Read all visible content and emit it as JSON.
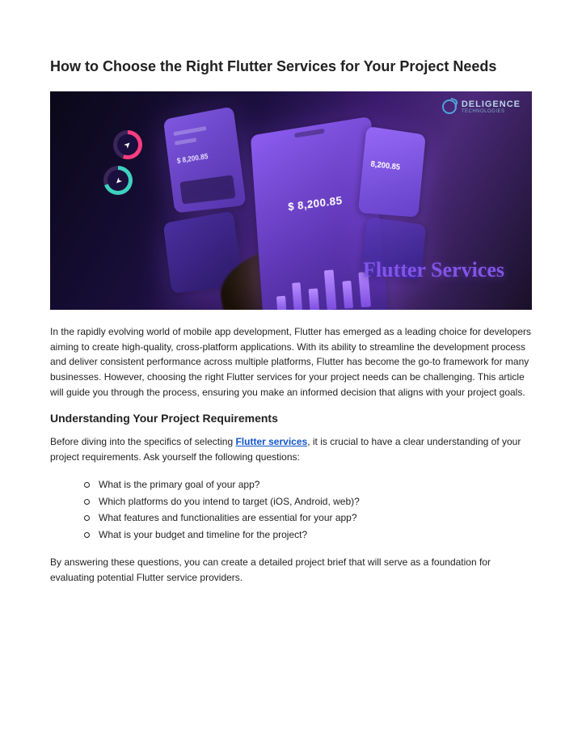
{
  "title": "How to Choose the Right Flutter Services for Your Project Needs",
  "hero": {
    "brand_name": "DELIGENCE",
    "brand_sub": "TECHNOLOGIES",
    "amount1": "$ 8,200.85",
    "amount2": "$ 8,200.85",
    "amount3": "8,200.85",
    "caption": "Flutter Services"
  },
  "intro": "In the rapidly evolving world of mobile app development, Flutter has emerged as a leading choice for developers aiming to create high-quality, cross-platform applications. With its ability to streamline the development process and deliver consistent performance across multiple platforms, Flutter has become the go-to framework for many businesses. However, choosing the right Flutter services for your project needs can be challenging. This article will guide you through the process, ensuring you make an informed decision that aligns with your project goals.",
  "section1": {
    "heading": "Understanding Your Project Requirements",
    "p1_pre": "Before diving into the specifics of selecting ",
    "p1_link": "Flutter services",
    "p1_post": ", it is crucial to have a clear understanding of your project requirements. Ask yourself the following questions:",
    "bullets": [
      "What is the primary goal of your app?",
      "Which platforms do you intend to target (iOS, Android, web)?",
      "What features and functionalities are essential for your app?",
      "What is your budget and timeline for the project?"
    ],
    "p2": "By answering these questions, you can create a detailed project brief that will serve as a foundation for evaluating potential Flutter service providers."
  }
}
